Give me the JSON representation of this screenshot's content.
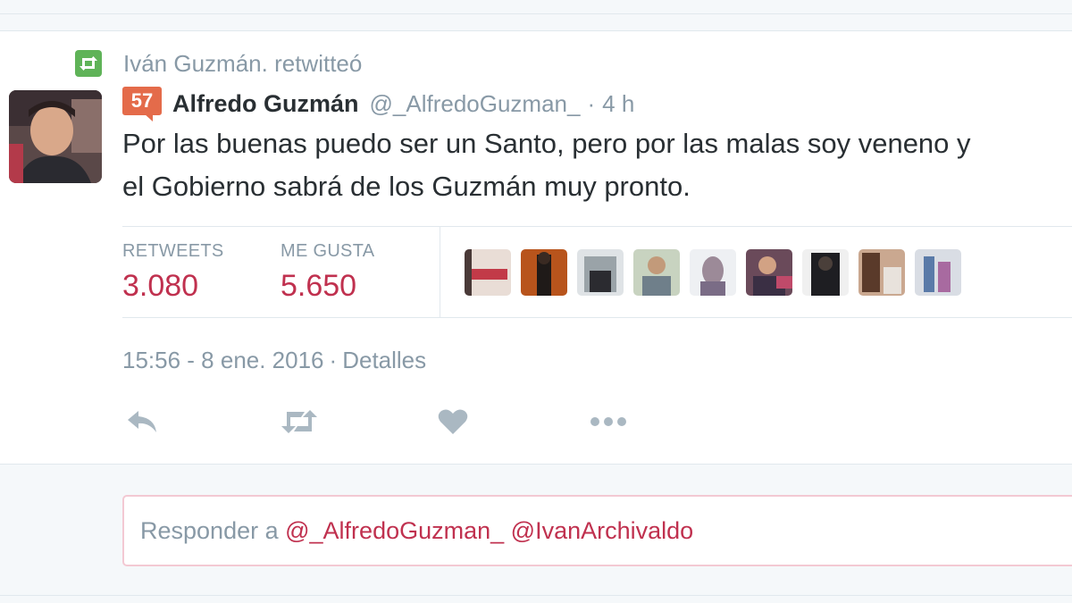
{
  "retweet_context": {
    "icon": "retweet-icon",
    "text": "Iván Guzmán. retwitteó",
    "badge_color": "#5fb358"
  },
  "tweet": {
    "klout_score": "57",
    "fullname": "Alfredo Guzmán",
    "username": "@_AlfredoGuzman_",
    "dot": "·",
    "time": "4 h",
    "text_line1": "Por las buenas puedo ser un Santo, pero por las malas soy veneno y",
    "text_line2": "el Gobierno sabrá de los Guzmán muy pronto."
  },
  "stats": {
    "retweets_label": "RETWEETS",
    "retweets_value": "3.080",
    "likes_label": "ME GUSTA",
    "likes_value": "5.650",
    "accent_color": "#c0314f"
  },
  "timestamp": {
    "datetime": "15:56 - 8 ene. 2016",
    "sep": "·",
    "details_link": "Detalles"
  },
  "actions": [
    "reply-icon",
    "retweet-icon",
    "heart-icon",
    "more-icon"
  ],
  "reply": {
    "prefix": "Responder a",
    "mention1": "@_AlfredoGuzman_",
    "mention2": "@IvanArchivaldo"
  }
}
